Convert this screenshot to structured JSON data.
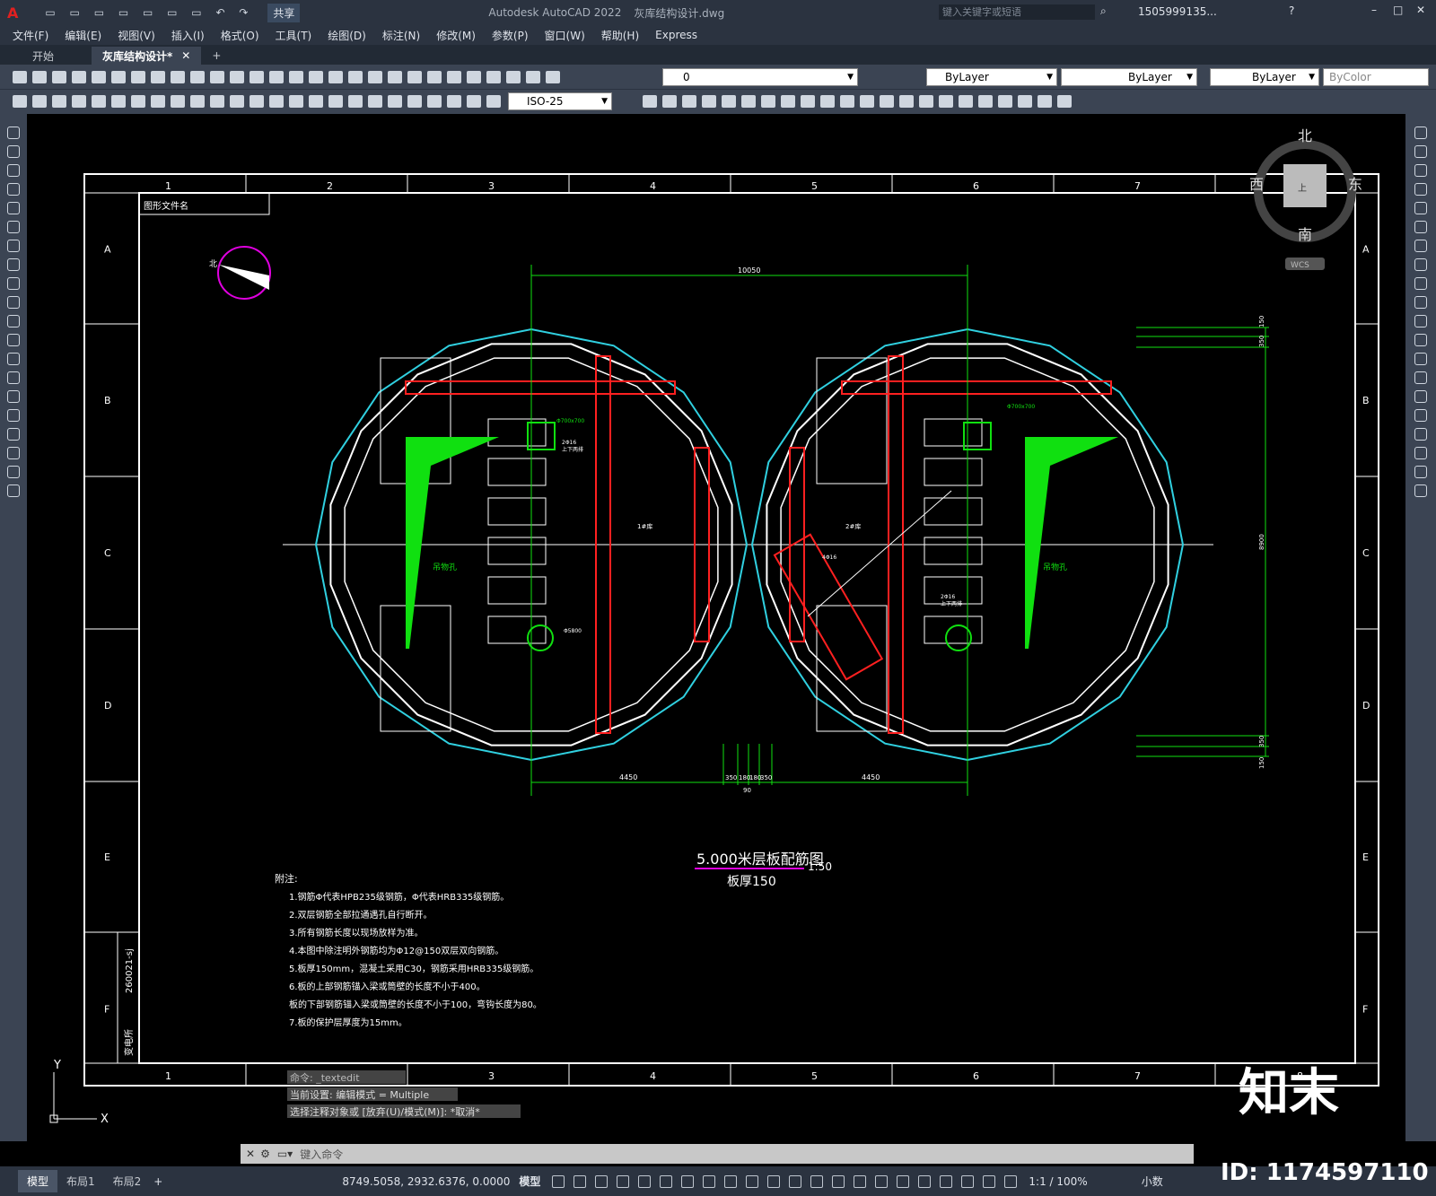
{
  "title": {
    "app": "Autodesk AutoCAD 2022",
    "file": "灰库结构设计.dwg",
    "share": "共享",
    "search_placeholder": "键入关键字或短语",
    "user": "1505999135..."
  },
  "menu": [
    "文件(F)",
    "编辑(E)",
    "视图(V)",
    "插入(I)",
    "格式(O)",
    "工具(T)",
    "绘图(D)",
    "标注(N)",
    "修改(M)",
    "参数(P)",
    "窗口(W)",
    "帮助(H)",
    "Express"
  ],
  "tabs": {
    "start": "开始",
    "doc": "灰库结构设计*",
    "add": "+"
  },
  "toolbar": {
    "layer": "0",
    "color": "ByLayer",
    "linetype": "ByLayer",
    "lineweight": "ByLayer",
    "plotstyle": "ByColor",
    "dimstyle": "ISO-25"
  },
  "viewcube": {
    "north": "北",
    "south": "南",
    "west": "西",
    "east": "东",
    "top": "上",
    "wcs": "WCS"
  },
  "drawing": {
    "col_labels": [
      "1",
      "2",
      "3",
      "4",
      "5",
      "6",
      "7",
      "8"
    ],
    "row_labels": [
      "A",
      "B",
      "C",
      "D",
      "E",
      "F"
    ],
    "file_label": "图形文件名",
    "side_code": "260021-sj",
    "side_name": "变电所",
    "dim_top": "10050",
    "dim_left": "4450",
    "dim_right": "4450",
    "dim_mid": [
      "350",
      "180",
      "180",
      "350"
    ],
    "dim_mid_total": "90",
    "dim_side": "8900",
    "dim_side_top": [
      "150",
      "350"
    ],
    "dim_side_bot": [
      "350",
      "150"
    ],
    "room_left": "1#库",
    "room_right": "2#库",
    "hole": "吊物孔",
    "rebar_notes": [
      "2Φ16",
      "上下两排",
      "Φ700x700",
      "Φ5800",
      "4Φ16"
    ],
    "heading": "5.000米层板配筋图",
    "scale": "1:50",
    "subheading": "板厚150",
    "notes_title": "附注:",
    "notes": [
      "1.钢筋Φ代表HPB235级钢筋，Φ代表HRB335级钢筋。",
      "2.双层钢筋全部拉通遇孔自行断开。",
      "3.所有钢筋长度以现场放样为准。",
      "4.本图中除注明外钢筋均为Φ12@150双层双向钢筋。",
      "5.板厚150mm，混凝土采用C30，钢筋采用HRB335级钢筋。",
      "6.板的上部钢筋锚入梁或筒壁的长度不小于400。",
      "  板的下部钢筋锚入梁或筒壁的长度不小于100，弯钩长度为80。",
      "7.板的保护层厚度为15mm。"
    ]
  },
  "command_history": [
    "命令: _textedit",
    "当前设置: 编辑模式 = Multiple",
    "选择注释对象或 [放弃(U)/模式(M)]: *取消*"
  ],
  "command_placeholder": "键入命令",
  "ucs": {
    "x": "X",
    "y": "Y"
  },
  "status": {
    "tabs": [
      "模型",
      "布局1",
      "布局2"
    ],
    "coords": "8749.5058, 2932.6376, 0.0000",
    "model": "模型",
    "scale": "1:1 / 100%",
    "units": "小数"
  },
  "watermark": {
    "brand": "知末",
    "id": "ID: 1174597110"
  },
  "colors": {
    "cyan": "#30d0e0",
    "red": "#ff2020",
    "green": "#10e010",
    "magenta": "#e000e0",
    "panel": "#3b4453"
  }
}
